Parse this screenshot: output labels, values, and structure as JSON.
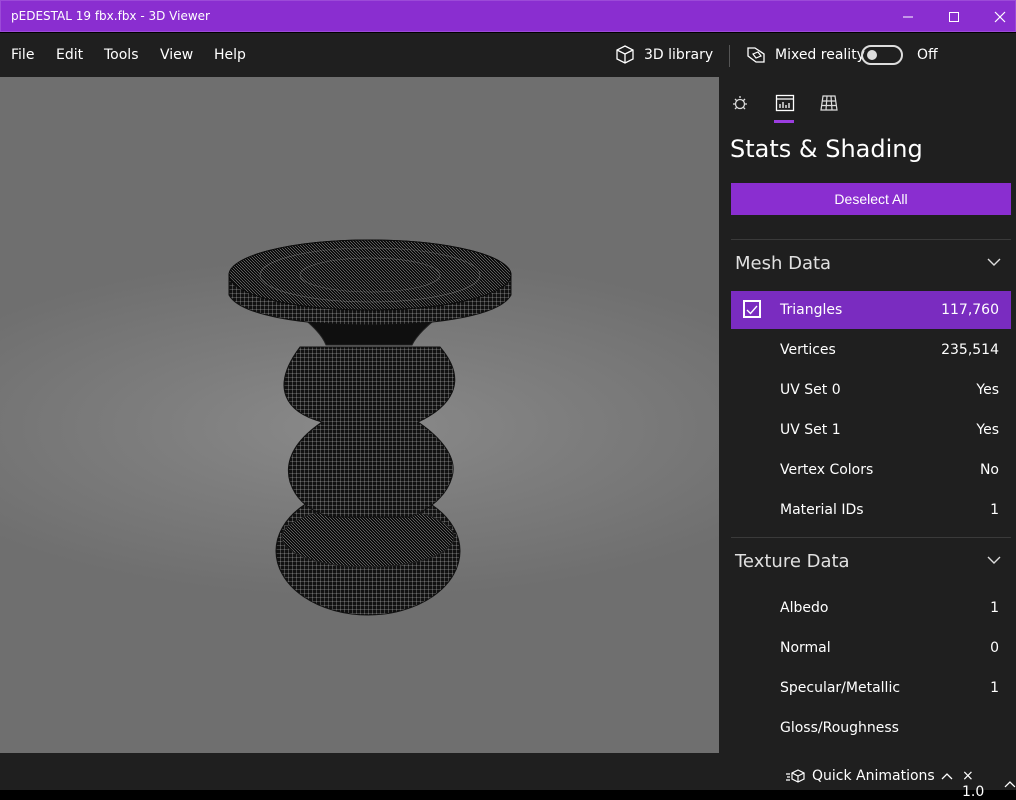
{
  "window": {
    "title": "pEDESTAL 19 fbx.fbx - 3D Viewer"
  },
  "menu": {
    "items": [
      "File",
      "Edit",
      "Tools",
      "View",
      "Help"
    ]
  },
  "toolbar": {
    "library_label": "3D library",
    "mixed_reality_label": "Mixed reality",
    "toggle_state": "Off"
  },
  "panel": {
    "title": "Stats & Shading",
    "deselect_label": "Deselect All",
    "mesh_section": {
      "label": "Mesh Data",
      "rows": [
        {
          "label": "Triangles",
          "value": "117,760"
        },
        {
          "label": "Vertices",
          "value": "235,514"
        },
        {
          "label": "UV Set 0",
          "value": "Yes"
        },
        {
          "label": "UV Set 1",
          "value": "Yes"
        },
        {
          "label": "Vertex Colors",
          "value": "No"
        },
        {
          "label": "Material IDs",
          "value": "1"
        }
      ]
    },
    "texture_section": {
      "label": "Texture Data",
      "rows": [
        {
          "label": "Albedo",
          "value": "1"
        },
        {
          "label": "Normal",
          "value": "0"
        },
        {
          "label": "Specular/Metallic",
          "value": "1"
        },
        {
          "label": "Gloss/Roughness",
          "value": ""
        }
      ]
    }
  },
  "status": {
    "animations_label": "Quick Animations",
    "speed_label": "× 1.0"
  },
  "colors": {
    "accent": "#8a2ed0",
    "panel_bg": "#1f1f1f",
    "viewport_bg": "#7d7d7d"
  },
  "icons": [
    "minimize-icon",
    "maximize-icon",
    "close-icon",
    "cube-library-icon",
    "mixed-reality-icon",
    "lighting-icon",
    "stats-icon",
    "grid-icon",
    "checkbox-check-icon",
    "chevron-down-icon",
    "chevron-up-icon",
    "animation-icon"
  ]
}
